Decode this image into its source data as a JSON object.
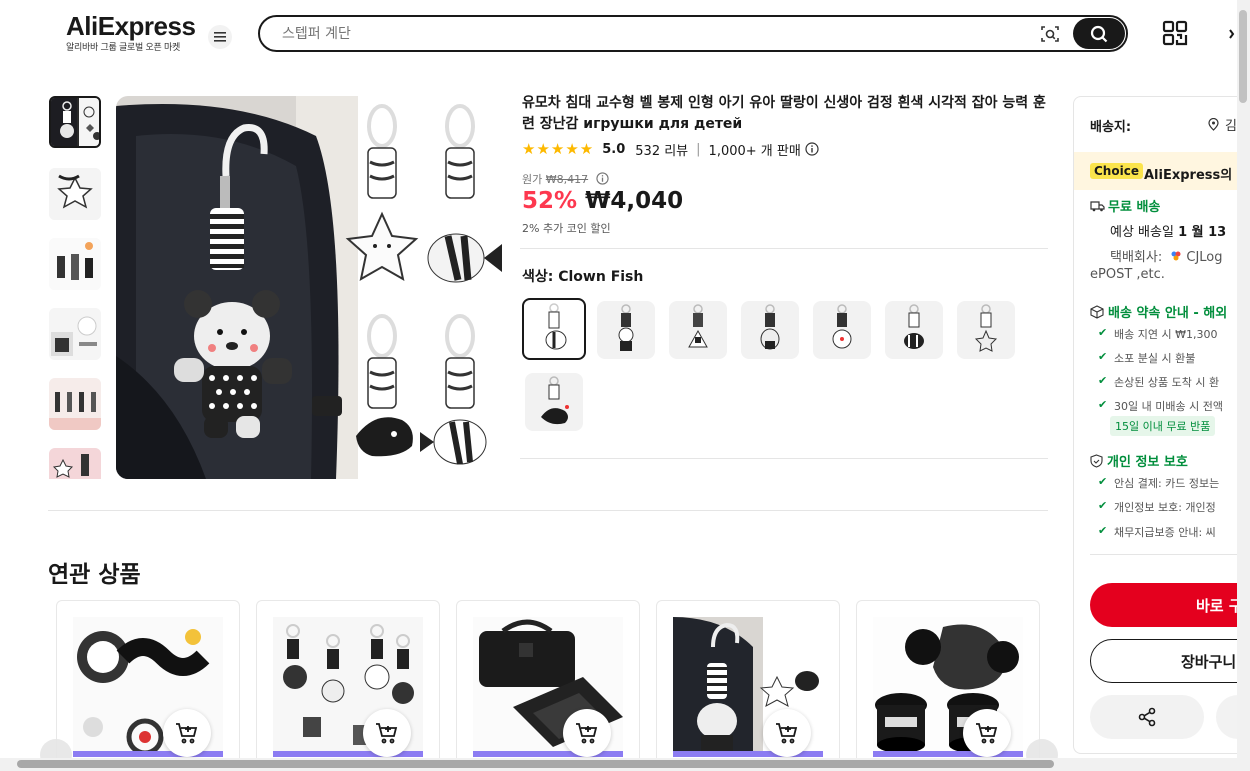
{
  "header": {
    "logo": "AliExpress",
    "logo_sub": "알리바바 그룹 글로벌 오픈 마켓",
    "search_placeholder": "스텝퍼 계단"
  },
  "product": {
    "title": "유모차 침대 교수형 벨 봉제 인형 아기 유아 딸랑이 신생아 검정 흰색 시각적 잡아 능력 훈련 장난감 игрушки для детей",
    "rating": "5.0",
    "reviews": "532 리뷰",
    "sold": "1,000+ 개 판매",
    "orig_label": "원가",
    "orig_price": "₩8,417",
    "discount": "52%",
    "price": "₩4,040",
    "coin_note": "2% 추가 코인 할인",
    "color_label": "색상: Clown Fish"
  },
  "related": {
    "title": "연관 상품"
  },
  "panel": {
    "ship_to": "배송지:",
    "ship_loc": "김",
    "choice_badge": "Choice",
    "choice_text": "AliExpress의 ",
    "free_shipping": "무료 배송",
    "eta_prefix": "예상 배송일 ",
    "eta_date": "1 월 13",
    "courier_label": "택배회사:",
    "courier_name": "CJLog",
    "courier_more": "ePOST ,etc.",
    "promise_title": "배송 약속 안내 - 해외",
    "promise_items": [
      "배송 지연 시 ₩1,300 ",
      "소포 분실 시 환불",
      "손상된 상품 도착 시 환",
      "30일 내 미배송 시 전액"
    ],
    "refund_tag": "15일 이내 무료 반품",
    "privacy_title": "개인 정보 보호",
    "privacy_items": [
      "안심 결제: 카드 정보는",
      "개인정보 보호: 개인정",
      "채무지급보증 안내: 씨"
    ],
    "buy_now": "바로 구",
    "add_cart": "장바구니"
  },
  "colors": {
    "accent_red": "#e4001e",
    "discount_red": "#fd384f",
    "green": "#018e3c",
    "star": "#fdb900"
  }
}
